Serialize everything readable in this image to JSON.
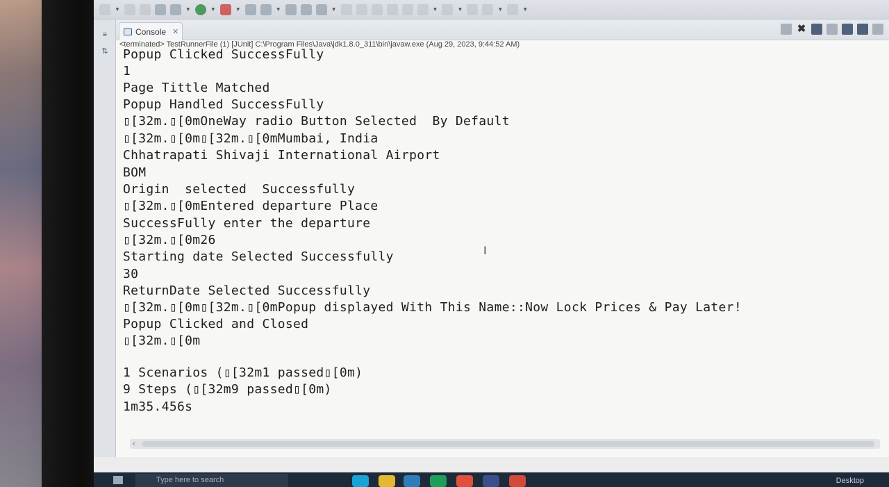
{
  "console_tab": {
    "label": "Console",
    "close_label": "✕"
  },
  "terminated_line": "<terminated> TestRunnerFile (1) [JUnit] C:\\Program Files\\Java\\jdk1.8.0_311\\bin\\javaw.exe (Aug 29, 2023, 9:44:52 AM)",
  "output_lines": [
    "Popup Clicked SuccessFully",
    "1",
    "Page Tittle Matched",
    "Popup Handled SuccessFully",
    "\u001b[32m.\u001b[0mOneWay radio Button Selected  By Default",
    "\u001b[32m.\u001b[0m\u001b[32m.\u001b[0mMumbai, India",
    "Chhatrapati Shivaji International Airport",
    "BOM",
    "Origin  selected  Successfully",
    "\u001b[32m.\u001b[0mEntered departure Place",
    "SuccessFully enter the departure",
    "\u001b[32m.\u001b[0m26",
    "Starting date Selected Successfully",
    "30",
    "ReturnDate Selected Successfully",
    "\u001b[32m.\u001b[0m\u001b[32m.\u001b[0mPopup displayed With This Name::Now Lock Prices & Pay Later!",
    "Popup Clicked and Closed",
    "\u001b[32m.\u001b[0m",
    "",
    "1 Scenarios (\u001b[32m1 passed\u001b[0m)",
    "9 Steps (\u001b[32m9 passed\u001b[0m)",
    "1m35.456s"
  ],
  "output_display": [
    "Popup Clicked SuccessFully",
    "1",
    "Page Tittle Matched",
    "Popup Handled SuccessFully",
    "▯[32m.▯[0mOneWay radio Button Selected  By Default",
    "▯[32m.▯[0m▯[32m.▯[0mMumbai, India",
    "Chhatrapati Shivaji International Airport",
    "BOM",
    "Origin  selected  Successfully",
    "▯[32m.▯[0mEntered departure Place",
    "SuccessFully enter the departure",
    "▯[32m.▯[0m26",
    "Starting date Selected Successfully",
    "30",
    "ReturnDate Selected Successfully",
    "▯[32m.▯[0m▯[32m.▯[0mPopup displayed With This Name::Now Lock Prices & Pay Later!",
    "Popup Clicked and Closed",
    "▯[32m.▯[0m",
    "",
    "1 Scenarios (▯[32m1 passed▯[0m)",
    "9 Steps (▯[32m9 passed▯[0m)",
    "1m35.456s"
  ],
  "taskbar": {
    "search_placeholder": "Type here to search",
    "desktop_label": "Desktop"
  },
  "colors": {
    "console_bg": "#f7f7f5",
    "toolbar_bg": "#d4d8de",
    "taskbar_bg": "#1d2a3a",
    "text": "#1f1f1f"
  }
}
